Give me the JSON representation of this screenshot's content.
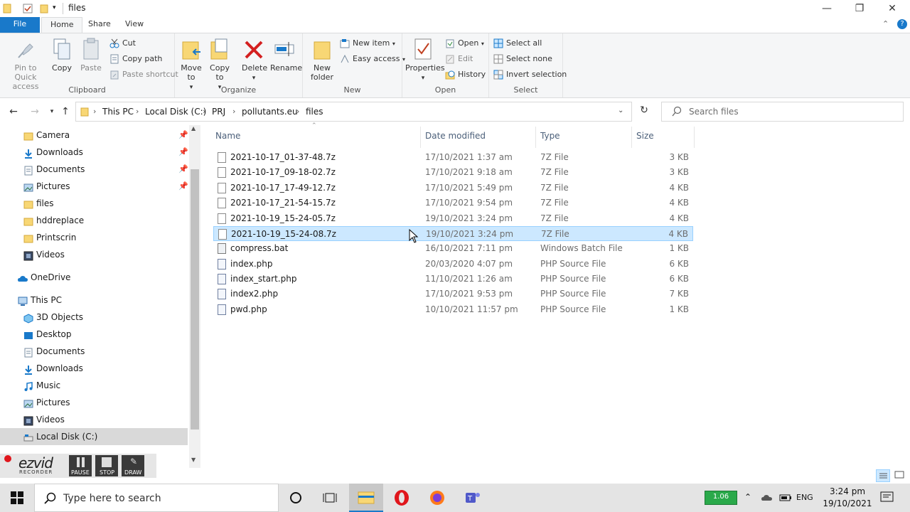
{
  "window": {
    "title": "files"
  },
  "ribbon_tabs": [
    {
      "label": "File"
    },
    {
      "label": "Home"
    },
    {
      "label": "Share"
    },
    {
      "label": "View"
    }
  ],
  "clipboard": {
    "group_label": "Clipboard",
    "pin_label": "Pin to Quick access",
    "copy_label": "Copy",
    "paste_label": "Paste",
    "cut_label": "Cut",
    "copy_path_label": "Copy path",
    "paste_shortcut_label": "Paste shortcut"
  },
  "organize": {
    "group_label": "Organize",
    "move_to_label": "Move to",
    "copy_to_label": "Copy to",
    "delete_label": "Delete",
    "rename_label": "Rename"
  },
  "new": {
    "group_label": "New",
    "new_folder_label": "New folder",
    "new_item_label": "New item",
    "easy_access_label": "Easy access"
  },
  "open": {
    "group_label": "Open",
    "properties_label": "Properties",
    "open_label": "Open",
    "edit_label": "Edit",
    "history_label": "History"
  },
  "select": {
    "group_label": "Select",
    "select_all_label": "Select all",
    "select_none_label": "Select none",
    "invert_label": "Invert selection"
  },
  "address": {
    "crumbs": [
      "This PC",
      "Local Disk (C:)",
      "PRJ",
      "pollutants.eu",
      "files"
    ]
  },
  "search": {
    "placeholder": "Search files"
  },
  "nav_pane": {
    "quick_access": [
      {
        "label": "Camera"
      },
      {
        "label": "Downloads"
      },
      {
        "label": "Documents"
      },
      {
        "label": "Pictures"
      },
      {
        "label": "files"
      },
      {
        "label": "hddreplace"
      },
      {
        "label": "Printscrin"
      },
      {
        "label": "Videos"
      }
    ],
    "onedrive": "OneDrive",
    "this_pc": "This PC",
    "this_pc_items": [
      {
        "label": "3D Objects"
      },
      {
        "label": "Desktop"
      },
      {
        "label": "Documents"
      },
      {
        "label": "Downloads"
      },
      {
        "label": "Music"
      },
      {
        "label": "Pictures"
      },
      {
        "label": "Videos"
      },
      {
        "label": "Local Disk (C:)"
      }
    ]
  },
  "columns": {
    "name": "Name",
    "date": "Date modified",
    "type": "Type",
    "size": "Size"
  },
  "files": [
    {
      "name": "2021-10-17_01-37-48.7z",
      "date": "17/10/2021 1:37 am",
      "type": "7Z File",
      "size": "3 KB"
    },
    {
      "name": "2021-10-17_09-18-02.7z",
      "date": "17/10/2021 9:18 am",
      "type": "7Z File",
      "size": "3 KB"
    },
    {
      "name": "2021-10-17_17-49-12.7z",
      "date": "17/10/2021 5:49 pm",
      "type": "7Z File",
      "size": "4 KB"
    },
    {
      "name": "2021-10-17_21-54-15.7z",
      "date": "17/10/2021 9:54 pm",
      "type": "7Z File",
      "size": "4 KB"
    },
    {
      "name": "2021-10-19_15-24-05.7z",
      "date": "19/10/2021 3:24 pm",
      "type": "7Z File",
      "size": "4 KB"
    },
    {
      "name": "2021-10-19_15-24-08.7z",
      "date": "19/10/2021 3:24 pm",
      "type": "7Z File",
      "size": "4 KB"
    },
    {
      "name": "compress.bat",
      "date": "16/10/2021 7:11 pm",
      "type": "Windows Batch File",
      "size": "1 KB"
    },
    {
      "name": "index.php",
      "date": "20/03/2020 4:07 pm",
      "type": "PHP Source File",
      "size": "6 KB"
    },
    {
      "name": "index_start.php",
      "date": "11/10/2021 1:26 am",
      "type": "PHP Source File",
      "size": "6 KB"
    },
    {
      "name": "index2.php",
      "date": "17/10/2021 9:53 pm",
      "type": "PHP Source File",
      "size": "7 KB"
    },
    {
      "name": "pwd.php",
      "date": "10/10/2021 11:57 pm",
      "type": "PHP Source File",
      "size": "1 KB"
    }
  ],
  "recorder": {
    "logo": "ezvid",
    "sub": "RECORDER",
    "pause": "PAUSE",
    "stop": "STOP",
    "draw": "DRAW"
  },
  "taskbar": {
    "search_placeholder": "Type here to search",
    "lang": "ENG",
    "time": "3:24 pm",
    "date": "19/10/2021",
    "battery_text": "1.06"
  },
  "colors": {
    "accent": "#1979ca",
    "selection": "#cce8ff",
    "selection_border": "#99d1ff",
    "folder": "#f8d775",
    "delete_red": "#d42020"
  }
}
